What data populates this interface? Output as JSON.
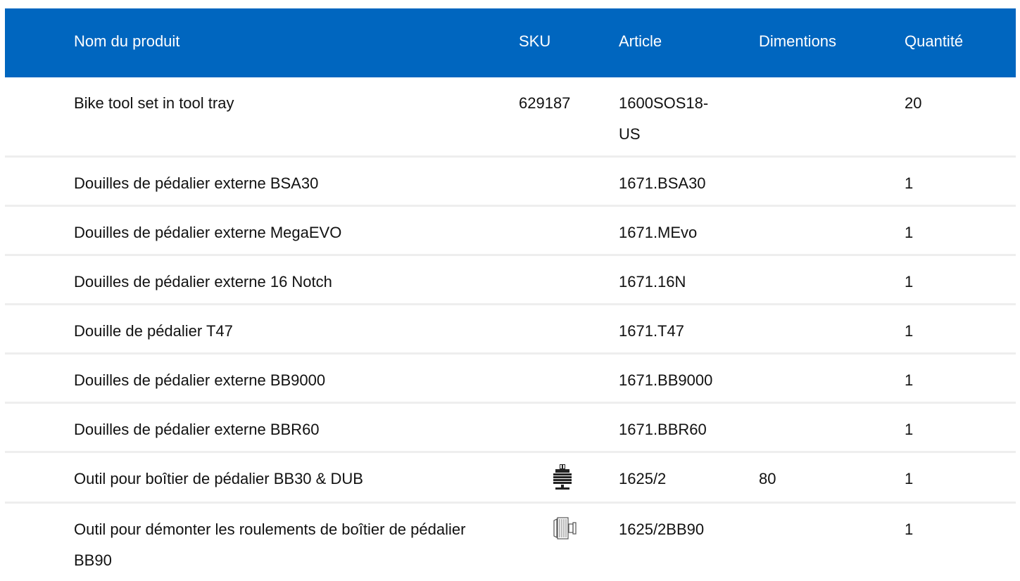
{
  "colors": {
    "header_bg": "#0066bf",
    "header_text": "#ffffff",
    "row_divider": "#eeeeee"
  },
  "columns": {
    "name": "Nom du produit",
    "sku": "SKU",
    "article": "Article",
    "dimensions": "Dimentions",
    "quantity": "Quantité"
  },
  "rows": [
    {
      "name": "Bike tool set in tool tray",
      "sku": "629187",
      "article": "1600SOS18-US",
      "dimensions": "",
      "quantity": "20"
    },
    {
      "name": "Douilles de pédalier externe BSA30",
      "sku": "",
      "article": "1671.BSA30",
      "dimensions": "",
      "quantity": "1"
    },
    {
      "name": "Douilles de pédalier externe MegaEVO",
      "sku": "",
      "article": "1671.MEvo",
      "dimensions": "",
      "quantity": "1"
    },
    {
      "name": "Douilles de pédalier externe 16 Notch",
      "sku": "",
      "article": "1671.16N",
      "dimensions": "",
      "quantity": "1"
    },
    {
      "name": "Douille de pédalier T47",
      "sku": "",
      "article": "1671.T47",
      "dimensions": "",
      "quantity": "1"
    },
    {
      "name": "Douilles de pédalier externe BB9000",
      "sku": "",
      "article": "1671.BB9000",
      "dimensions": "",
      "quantity": "1"
    },
    {
      "name": "Douilles de pédalier externe BBR60",
      "sku": "",
      "article": "1671.BBR60",
      "dimensions": "",
      "quantity": "1"
    },
    {
      "name": "Outil pour boîtier de pédalier BB30 & DUB",
      "sku": "",
      "sku_icon": "bottom-bracket-press-tool-icon",
      "article": "1625/2",
      "dimensions": "80",
      "quantity": "1"
    },
    {
      "name": "Outil pour démonter les roulements de boîtier de pédalier BB90",
      "sku": "",
      "sku_icon": "bearing-removal-tool-icon",
      "article": "1625/2BB90",
      "dimensions": "",
      "quantity": "1"
    }
  ]
}
